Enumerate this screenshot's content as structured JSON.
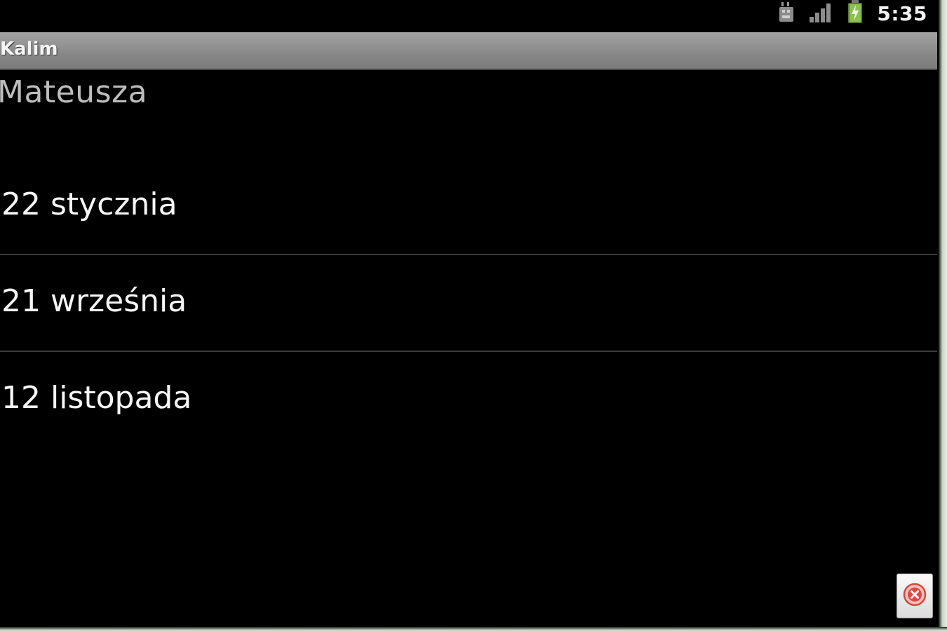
{
  "status_bar": {
    "time": "5:35",
    "icons": [
      "usb-debugging-icon",
      "signal-icon",
      "battery-charging-icon"
    ],
    "battery_color": "#8bc34a"
  },
  "title_bar": {
    "title": "Kalim"
  },
  "list": {
    "header": "Mateusza",
    "items": [
      {
        "label": "22 stycznia"
      },
      {
        "label": "21 września"
      },
      {
        "label": "12 listopada"
      }
    ]
  },
  "close_button": {
    "icon": "close-icon",
    "color": "#e0483e"
  }
}
